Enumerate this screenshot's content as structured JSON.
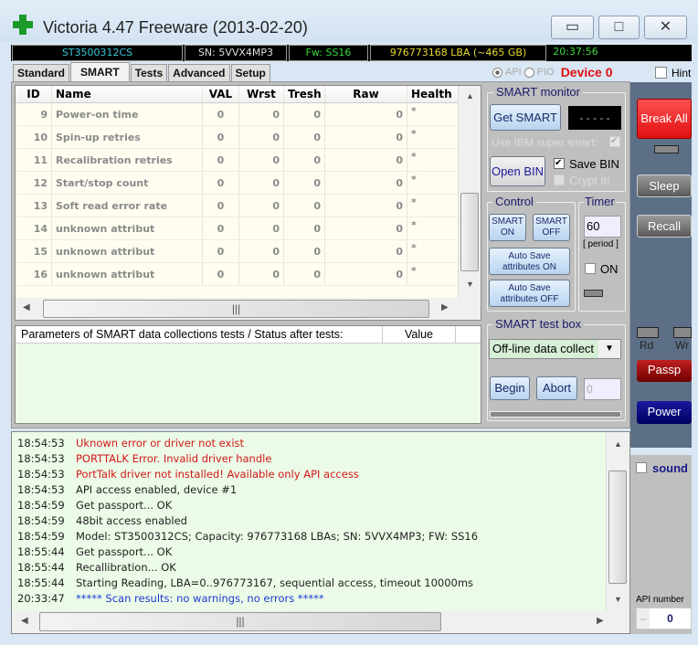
{
  "window": {
    "title": "Victoria 4.47  Freeware (2013-02-20)",
    "minimize": "▭",
    "maximize": "□",
    "close": "✕"
  },
  "infobar": {
    "model": "ST3500312CS",
    "serial": "SN: 5VVX4MP3",
    "firmware": "Fw: SS16",
    "capacity": "976773168 LBA (~465 GB)",
    "time": "20:37:56"
  },
  "tabs": [
    "Standard",
    "SMART",
    "Tests",
    "Advanced",
    "Setup"
  ],
  "mode": {
    "api": "API",
    "pio": "PIO",
    "device": "Device 0",
    "hint": "Hint"
  },
  "smart_table": {
    "columns": [
      "ID",
      "Name",
      "VAL",
      "Wrst",
      "Tresh",
      "Raw",
      "Health"
    ],
    "rows": [
      [
        "9",
        "Power-on time",
        "0",
        "0",
        "0",
        "0",
        "*"
      ],
      [
        "10",
        "Spin-up retries",
        "0",
        "0",
        "0",
        "0",
        "*"
      ],
      [
        "11",
        "Recalibration retries",
        "0",
        "0",
        "0",
        "0",
        "*"
      ],
      [
        "12",
        "Start/stop count",
        "0",
        "0",
        "0",
        "0",
        "*"
      ],
      [
        "13",
        "Soft read error rate",
        "0",
        "0",
        "0",
        "0",
        "*"
      ],
      [
        "14",
        "unknown attribut",
        "0",
        "0",
        "0",
        "0",
        "*"
      ],
      [
        "15",
        "unknown attribut",
        "0",
        "0",
        "0",
        "0",
        "*"
      ],
      [
        "16",
        "unknown attribut",
        "0",
        "0",
        "0",
        "0",
        "*"
      ]
    ]
  },
  "params": {
    "col1": "Parameters of SMART data collections tests / Status after tests:",
    "col2": "Value"
  },
  "smart_monitor": {
    "label": "SMART monitor",
    "get_smart": "Get SMART",
    "display": "- - - - -",
    "ibm": "Use IBM super smart:",
    "open_bin": "Open BIN",
    "save_bin": "Save BIN",
    "crypt": "Crypt it!"
  },
  "control": {
    "label": "Control",
    "smart_on": [
      "SMART",
      "ON"
    ],
    "smart_off": [
      "SMART",
      "OFF"
    ],
    "auto_on": [
      "Auto Save",
      "attributes ON"
    ],
    "auto_off": [
      "Auto Save",
      "attributes OFF"
    ]
  },
  "timer": {
    "label": "Timer",
    "value": "60",
    "period": "[ period ]",
    "on": "ON"
  },
  "test_box": {
    "label": "SMART test box",
    "selected": "Off-line data collect",
    "begin": "Begin",
    "abort": "Abort",
    "value": "0"
  },
  "side": {
    "break_all": "Break All",
    "sleep": "Sleep",
    "recall": "Recall",
    "rd": "Rd",
    "wr": "Wr",
    "passp": "Passp",
    "power": "Power",
    "sound": "sound",
    "api_number": "API number",
    "api_value": "0",
    "minus": "–"
  },
  "log": [
    {
      "time": "18:54:53",
      "text": "Uknown error or driver not exist",
      "color": "#d01818"
    },
    {
      "time": "18:54:53",
      "text": "PORTTALK Error. Invalid driver handle",
      "color": "#d01818"
    },
    {
      "time": "18:54:53",
      "text": "PortTalk driver not installed! Available only API access",
      "color": "#d01818"
    },
    {
      "time": "18:54:53",
      "text": "API access enabled, device #1",
      "color": "#222222"
    },
    {
      "time": "18:54:59",
      "text": "Get passport... OK",
      "color": "#222222"
    },
    {
      "time": "18:54:59",
      "text": "48bit access enabled",
      "color": "#222222"
    },
    {
      "time": "18:54:59",
      "text": "Model: ST3500312CS; Capacity: 976773168 LBAs; SN: 5VVX4MP3; FW: SS16",
      "color": "#222222"
    },
    {
      "time": "18:55:44",
      "text": "Get passport... OK",
      "color": "#222222"
    },
    {
      "time": "18:55:44",
      "text": "Recallibration... OK",
      "color": "#222222"
    },
    {
      "time": "18:55:44",
      "text": "Starting Reading, LBA=0..976773167, sequential access, timeout 10000ms",
      "color": "#222222"
    },
    {
      "time": "20:33:47",
      "text": "***** Scan results: no warnings, no errors *****",
      "color": "#1a3ad0"
    }
  ]
}
